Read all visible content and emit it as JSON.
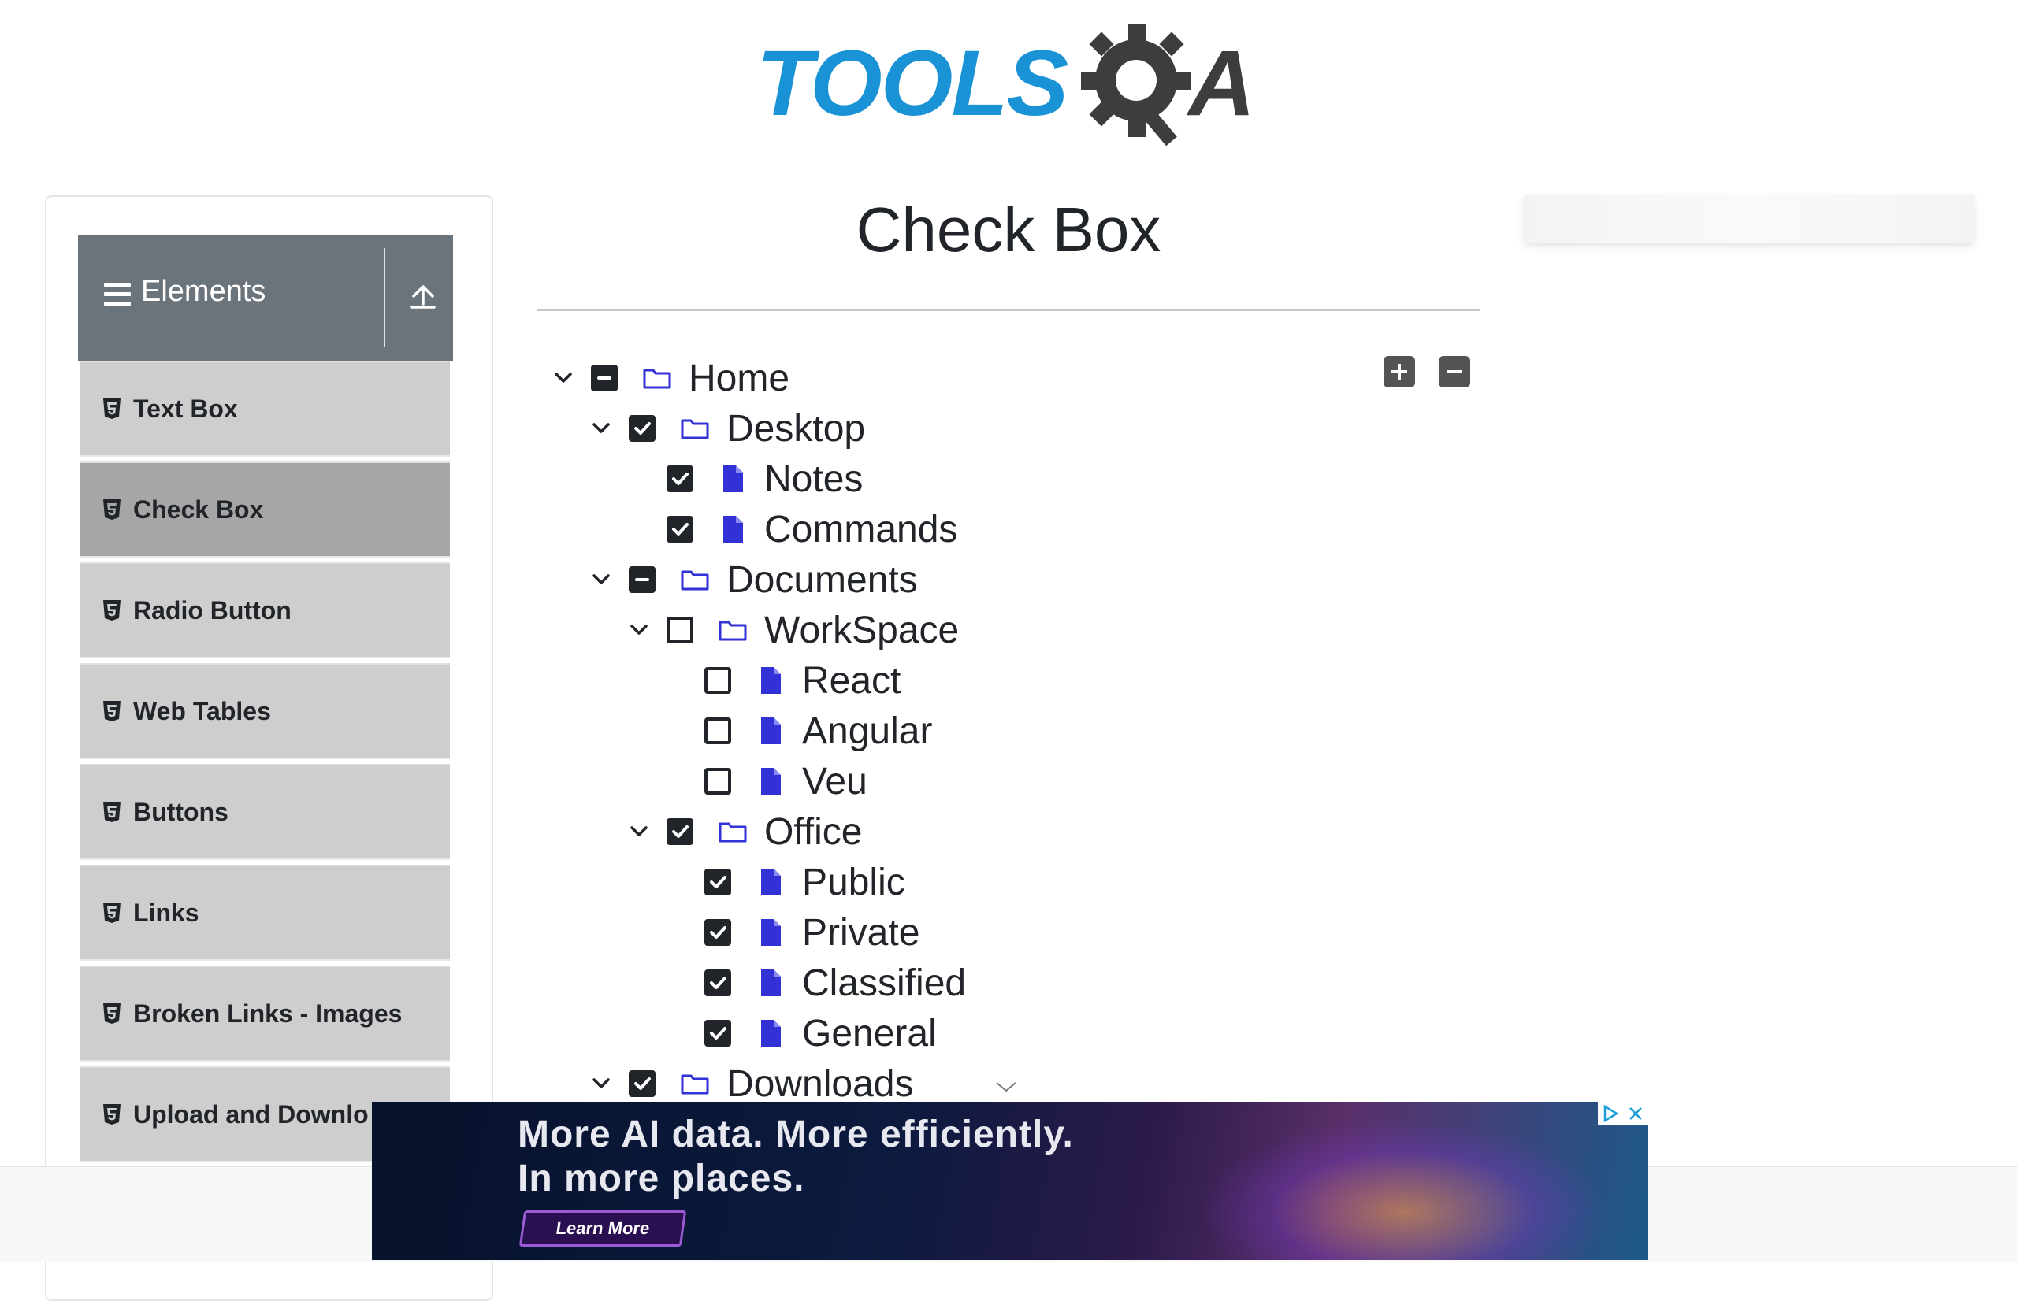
{
  "logo": {
    "part1": "TOOLS",
    "part2": "A"
  },
  "sidebar": {
    "group_title": "Elements",
    "items": [
      {
        "label": "Text Box",
        "active": false
      },
      {
        "label": "Check Box",
        "active": true
      },
      {
        "label": "Radio Button",
        "active": false
      },
      {
        "label": "Web Tables",
        "active": false
      },
      {
        "label": "Buttons",
        "active": false
      },
      {
        "label": "Links",
        "active": false
      },
      {
        "label": "Broken Links - Images",
        "active": false
      },
      {
        "label": "Upload and Downlo",
        "active": false
      }
    ]
  },
  "main": {
    "title": "Check Box",
    "tree": [
      {
        "label": "Home",
        "state": "half",
        "type": "folder",
        "expandable": true
      },
      {
        "label": "Desktop",
        "state": "checked",
        "type": "folder",
        "expandable": true
      },
      {
        "label": "Notes",
        "state": "checked",
        "type": "file",
        "expandable": false
      },
      {
        "label": "Commands",
        "state": "checked",
        "type": "file",
        "expandable": false
      },
      {
        "label": "Documents",
        "state": "half",
        "type": "folder",
        "expandable": true
      },
      {
        "label": "WorkSpace",
        "state": "unchecked",
        "type": "folder",
        "expandable": true
      },
      {
        "label": "React",
        "state": "unchecked",
        "type": "file",
        "expandable": false
      },
      {
        "label": "Angular",
        "state": "unchecked",
        "type": "file",
        "expandable": false
      },
      {
        "label": "Veu",
        "state": "unchecked",
        "type": "file",
        "expandable": false
      },
      {
        "label": "Office",
        "state": "checked",
        "type": "folder",
        "expandable": true
      },
      {
        "label": "Public",
        "state": "checked",
        "type": "file",
        "expandable": false
      },
      {
        "label": "Private",
        "state": "checked",
        "type": "file",
        "expandable": false
      },
      {
        "label": "Classified",
        "state": "checked",
        "type": "file",
        "expandable": false
      },
      {
        "label": "General",
        "state": "checked",
        "type": "file",
        "expandable": false
      },
      {
        "label": "Downloads",
        "state": "checked",
        "type": "folder",
        "expandable": true
      }
    ]
  },
  "ad": {
    "line1": "More AI data. More efficiently.",
    "line2": "In more places.",
    "cta": "Learn More"
  },
  "colors": {
    "accent_icon": "#3131d6",
    "sidebar_header": "#6b737b",
    "logo_blue": "#1a93d6"
  }
}
